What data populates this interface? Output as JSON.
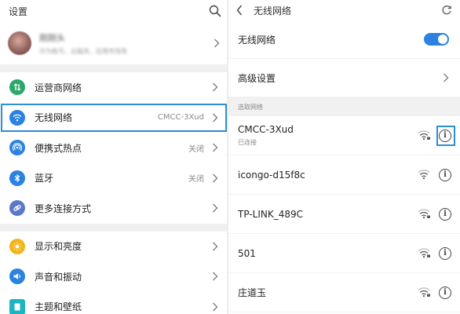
{
  "left": {
    "title": "设置",
    "profile": {
      "name": "刚刚头",
      "subtitle": "华为帐号、云服务、应用市场等"
    },
    "items": [
      {
        "label": "运营商网络",
        "value": "",
        "icon_color": "#2aa96b",
        "icon": "mobile-network-icon"
      },
      {
        "label": "无线网络",
        "value": "CMCC-3Xud",
        "icon_color": "#2b82e0",
        "icon": "wifi-icon"
      },
      {
        "label": "便携式热点",
        "value": "关闭",
        "icon_color": "#2b82e0",
        "icon": "hotspot-icon"
      },
      {
        "label": "蓝牙",
        "value": "关闭",
        "icon_color": "#2b82e0",
        "icon": "bluetooth-icon"
      },
      {
        "label": "更多连接方式",
        "value": "",
        "icon_color": "#5b79c9",
        "icon": "link-icon"
      },
      {
        "label": "显示和亮度",
        "value": "",
        "icon_color": "#f3b51c",
        "icon": "brightness-icon"
      },
      {
        "label": "声音和振动",
        "value": "",
        "icon_color": "#2b82e0",
        "icon": "sound-icon"
      },
      {
        "label": "主题和壁纸",
        "value": "",
        "icon_color": "#1ab6c4",
        "icon": "theme-icon"
      }
    ]
  },
  "right": {
    "title": "无线网络",
    "wifi_toggle_label": "无线网络",
    "wifi_enabled": true,
    "advanced_label": "高级设置",
    "section_label": "选取网络",
    "networks": [
      {
        "ssid": "CMCC-3Xud",
        "status": "已连接"
      },
      {
        "ssid": "icongo-d15f8c",
        "status": ""
      },
      {
        "ssid": "TP-LINK_489C",
        "status": ""
      },
      {
        "ssid": "501",
        "status": ""
      },
      {
        "ssid": "庄道玉",
        "status": ""
      }
    ]
  },
  "colors": {
    "accent": "#2b82e0",
    "highlight": "#2a8fd6"
  }
}
